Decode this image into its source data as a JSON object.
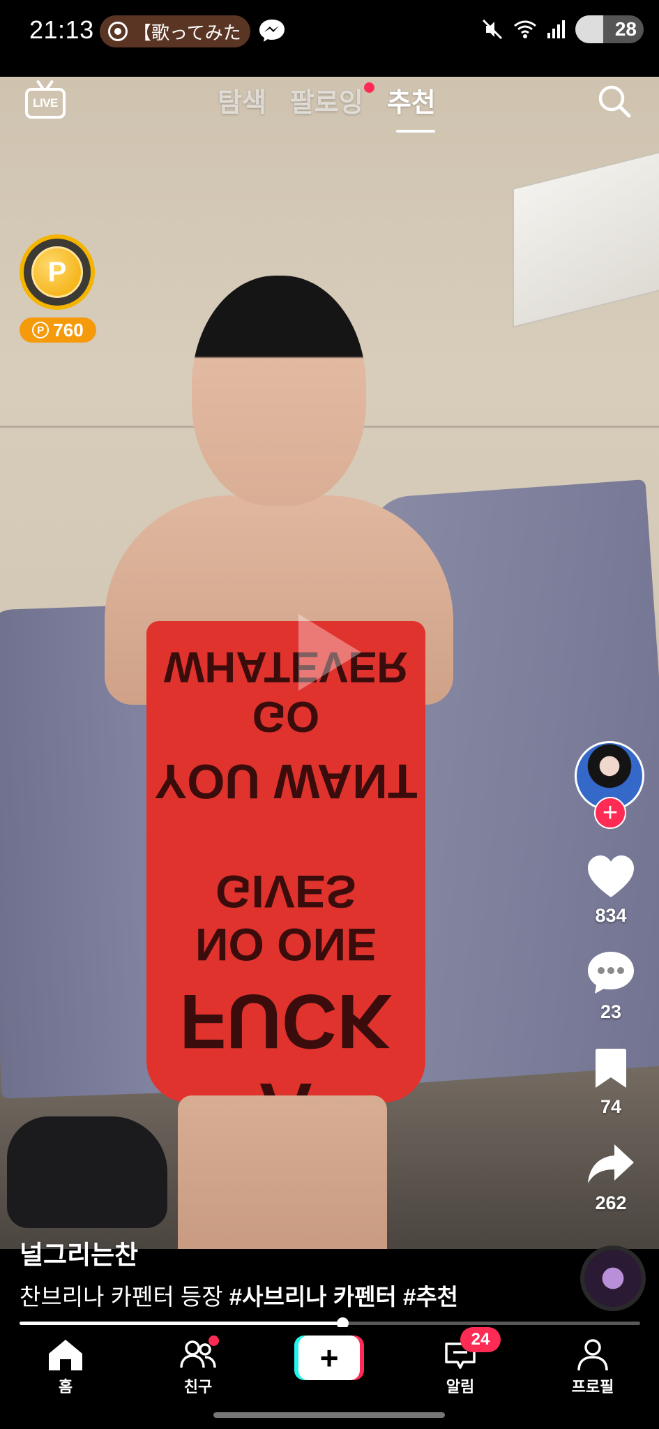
{
  "status_bar": {
    "time": "21:13",
    "notification_text": "【歌ってみた",
    "battery": "28"
  },
  "top_nav": {
    "live_label": "LIVE",
    "tabs": [
      {
        "label": "탐색",
        "active": false,
        "dot": false
      },
      {
        "label": "팔로잉",
        "active": false,
        "dot": true
      },
      {
        "label": "추천",
        "active": true,
        "dot": false
      }
    ]
  },
  "coin_widget": {
    "icon_letter": "P",
    "count": "760"
  },
  "rail": {
    "likes": "834",
    "comments": "23",
    "saves": "74",
    "shares": "262"
  },
  "video": {
    "dress_lines": [
      "GO WHATEVER",
      "YOU WANT",
      "NO ONE GIVES",
      "A FUCK"
    ],
    "progress": 0.52
  },
  "caption": {
    "username": "널그리는찬",
    "text": "찬브리나 카펜터 등장 ",
    "hashtags": [
      "#사브리나 카펜터",
      "#추천"
    ]
  },
  "bottom_nav": {
    "items": [
      {
        "label": "홈"
      },
      {
        "label": "친구"
      },
      {
        "label": ""
      },
      {
        "label": "알림",
        "badge": "24"
      },
      {
        "label": "프로필"
      }
    ]
  },
  "colors": {
    "accent_red": "#fe2c55",
    "accent_cyan": "#25f4ee",
    "coin_gold": "#f4b400"
  }
}
